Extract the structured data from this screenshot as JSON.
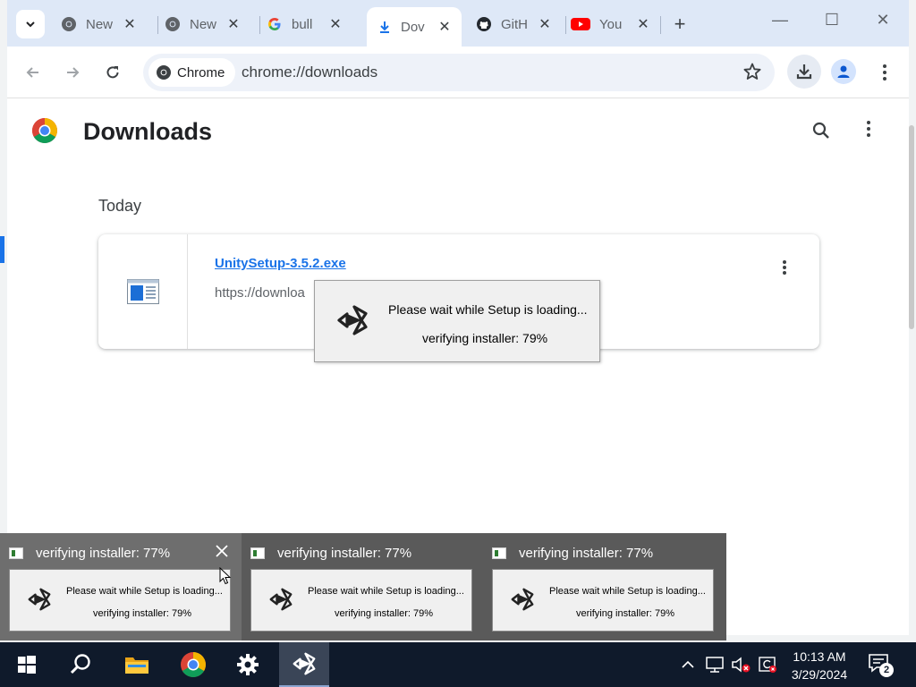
{
  "browser": {
    "tabs": [
      {
        "title": "New",
        "icon": "chrome-icon"
      },
      {
        "title": "New",
        "icon": "chrome-icon"
      },
      {
        "title": "bull",
        "icon": "google-icon"
      },
      {
        "title": "Dov",
        "icon": "download-icon",
        "active": true
      },
      {
        "title": "GitH",
        "icon": "github-icon"
      },
      {
        "title": "You",
        "icon": "youtube-icon"
      }
    ],
    "omnibox": {
      "chip_label": "Chrome",
      "url": "chrome://downloads"
    }
  },
  "downloads": {
    "title": "Downloads",
    "section": "Today",
    "items": [
      {
        "filename": "UnitySetup-3.5.2.exe",
        "url": "https://downloa"
      }
    ]
  },
  "setup_dialog": {
    "message": "Please wait while Setup is loading...",
    "status": "verifying installer: 79%"
  },
  "thumbnails": [
    {
      "title": "verifying installer: 77%",
      "message": "Please wait while Setup is loading...",
      "status": "verifying installer: 79%"
    },
    {
      "title": "verifying installer: 77%",
      "message": "Please wait while Setup is loading...",
      "status": "verifying installer: 79%"
    },
    {
      "title": "verifying installer: 77%",
      "message": "Please wait while Setup is loading...",
      "status": "verifying installer: 79%"
    }
  ],
  "taskbar": {
    "apps": [
      "start-icon",
      "search-icon",
      "file-explorer-icon",
      "chrome-icon",
      "settings-icon",
      "unity-setup-icon"
    ],
    "time": "10:13 AM",
    "date": "3/29/2024",
    "notification_count": "2"
  },
  "colors": {
    "accent": "#1a73e8",
    "tabstrip": "#dee8f7",
    "taskbar": "#0f1a2b"
  }
}
